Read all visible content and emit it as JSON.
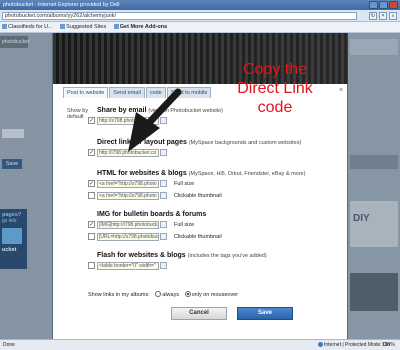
{
  "browser": {
    "title": "photobucket - Internet Explorer provided by Dell",
    "url": "photobucket.com/albums/yy262/alchemyjunk/",
    "favorites": [
      {
        "label": "Classifieds for U..."
      },
      {
        "label": "Suggested Sites"
      },
      {
        "label": "Get More Add-ons"
      }
    ],
    "status_done": "Done",
    "status_zone": "Internet | Protected Mode: On",
    "status_zoom": "100%"
  },
  "background_page": {
    "left_tab": "photobucket",
    "save_label": "Save",
    "ad_heading": "pages?",
    "ad_text": "gs lets",
    "ad_word": "ucket",
    "right_text": "DIY"
  },
  "dialog": {
    "close": "×",
    "tabs": [
      {
        "label": "Post to website"
      },
      {
        "label": "Send email"
      },
      {
        "label": "code"
      },
      {
        "label": "Send to mobile"
      }
    ],
    "show_by_default": "Show by default",
    "options": [
      {
        "title": "Share by email",
        "desc": "(view on Photobucket website)",
        "code": "http://s798.photobucket",
        "checked": true
      },
      {
        "title": "Direct link for layout pages",
        "desc": "(MySpace backgrounds and custom websites)",
        "code": "http://i798.photobucket.co",
        "checked": true
      },
      {
        "title": "HTML for websites & blogs",
        "desc": "(MySpace, Hi5, Orkut, Friendster, eBay & more)",
        "code": "<a href=\"http://s798.photo",
        "code2": "<a href=\"http://s798.photo",
        "sub1": "Full size",
        "sub2": "Clickable thumbnail",
        "checked": true,
        "checked2": false
      },
      {
        "title": "IMG for bulletin boards & forums",
        "desc": "",
        "code": "[IMG]http://i798.photobuck",
        "code2": "[URL=http://s798.photobuc",
        "sub1": "Full size",
        "sub2": "Clickable thumbnail",
        "checked": true,
        "checked2": false
      },
      {
        "title": "Flash for websites & blogs",
        "desc": "(includes the tags you've added)",
        "code": "<table border=\"0\" width=\"",
        "checked": false
      }
    ],
    "show_links_label": "Show links in my albums:",
    "radio_always": "always",
    "radio_mouseover": "only on mouseover",
    "cancel_label": "Cancel",
    "save_label": "Save"
  },
  "annotation": {
    "lines": [
      "Copy the",
      "Direct Link",
      "code"
    ],
    "color": "#e3141c"
  }
}
